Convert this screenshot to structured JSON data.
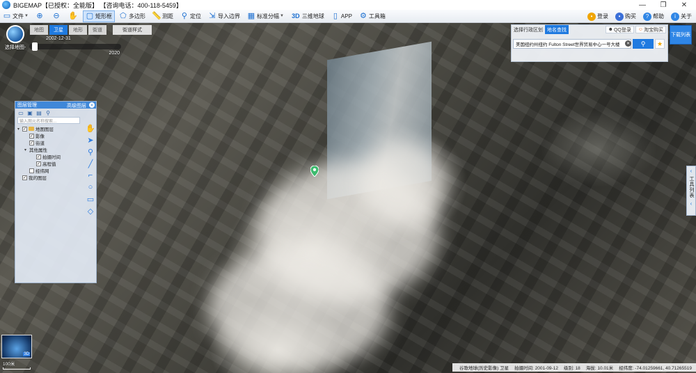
{
  "app": {
    "title": "BIGEMAP【已授权：全能版】 【咨询电话：400-118-5459】"
  },
  "window": {
    "minimize": "—",
    "maximize": "❐",
    "close": "✕"
  },
  "toolbar": {
    "items": [
      {
        "id": "file",
        "label": "文件",
        "icon": "folder-icon",
        "glyph": "▭",
        "dropdown": true
      },
      {
        "id": "zoom-in",
        "label": "",
        "icon": "zoom-in-icon",
        "glyph": "⊕"
      },
      {
        "id": "zoom-out",
        "label": "",
        "icon": "zoom-out-icon",
        "glyph": "⊖"
      },
      {
        "id": "pan",
        "label": "",
        "icon": "hand-icon",
        "glyph": "✋"
      },
      {
        "id": "rect",
        "label": "矩形框",
        "icon": "rectangle-icon",
        "glyph": "▢",
        "active": true
      },
      {
        "id": "polygon",
        "label": "多边形",
        "icon": "polygon-icon",
        "glyph": "⬠"
      },
      {
        "id": "measure",
        "label": "测距",
        "icon": "ruler-icon",
        "glyph": "📏"
      },
      {
        "id": "locate",
        "label": "定位",
        "icon": "location-pin-icon",
        "glyph": "⚲"
      },
      {
        "id": "import",
        "label": "导入边界",
        "icon": "import-icon",
        "glyph": "⇲"
      },
      {
        "id": "grid",
        "label": "标准分幅",
        "icon": "grid-icon",
        "glyph": "▦",
        "dropdown": true
      },
      {
        "id": "3d",
        "label": "三维地球",
        "icon": "3d-icon",
        "glyph": "3D"
      },
      {
        "id": "app",
        "label": "APP",
        "icon": "phone-icon",
        "glyph": "▯"
      },
      {
        "id": "tools",
        "label": "工具箱",
        "icon": "gear-icon",
        "glyph": "⚙"
      }
    ],
    "right": [
      {
        "id": "login",
        "label": "登录",
        "icon": "user-icon",
        "color": "#f0a500"
      },
      {
        "id": "share",
        "label": "购买",
        "icon": "cart-icon",
        "color": "#3a6fd8"
      },
      {
        "id": "help",
        "label": "帮助",
        "icon": "help-icon",
        "color": "#2f86e6"
      },
      {
        "id": "about",
        "label": "关于",
        "icon": "info-icon",
        "color": "#2f86e6"
      }
    ]
  },
  "map_type": {
    "label": "选择地图-",
    "tabs": [
      {
        "label": "地图",
        "on": false
      },
      {
        "label": "卫星",
        "on": true
      },
      {
        "label": "地形",
        "on": false
      },
      {
        "label": "街道",
        "on": false
      }
    ],
    "style_button": "街道样式"
  },
  "timeline": {
    "date": "2002-12-31",
    "end_label": "2020",
    "position": 0.02
  },
  "layer_panel": {
    "title": "图层管理",
    "link": "高级图层",
    "search_placeholder": "输入图元名称搜索...",
    "tree": [
      {
        "label": "地图图层",
        "level": 0,
        "checked": true,
        "folder": true,
        "expanded": true
      },
      {
        "label": "影像",
        "level": 1,
        "checked": true
      },
      {
        "label": "街道",
        "level": 1,
        "checked": true
      },
      {
        "label": "其他属性",
        "level": 1,
        "checked": null,
        "expanded": true
      },
      {
        "label": "拍摄时间",
        "level": 2,
        "checked": true
      },
      {
        "label": "高程值",
        "level": 2,
        "checked": true
      },
      {
        "label": "经纬网",
        "level": 1,
        "checked": false
      },
      {
        "label": "我的图层",
        "level": 0,
        "checked": true
      }
    ]
  },
  "search": {
    "tab_region": "选择行政区划",
    "tab_place": "地名查找",
    "qq_login": "QQ登录",
    "taobao": "淘宝购买",
    "query": "美国纽约州纽约 Fulton Street世界贸易中心一号大楼",
    "download_button": "下载列表"
  },
  "right_tool": {
    "label": "工具列表"
  },
  "overview": {
    "three_d": "3D"
  },
  "scale": {
    "label": "100米"
  },
  "status": {
    "source": "谷歌地球(历史影像) 卫星",
    "capture_time": "拍摄时间: 2001-09-12",
    "zoom": "级别: 18",
    "elevation": "海拔: 10.01米",
    "coords": "经纬度: -74.01259661, 40.71265519"
  }
}
